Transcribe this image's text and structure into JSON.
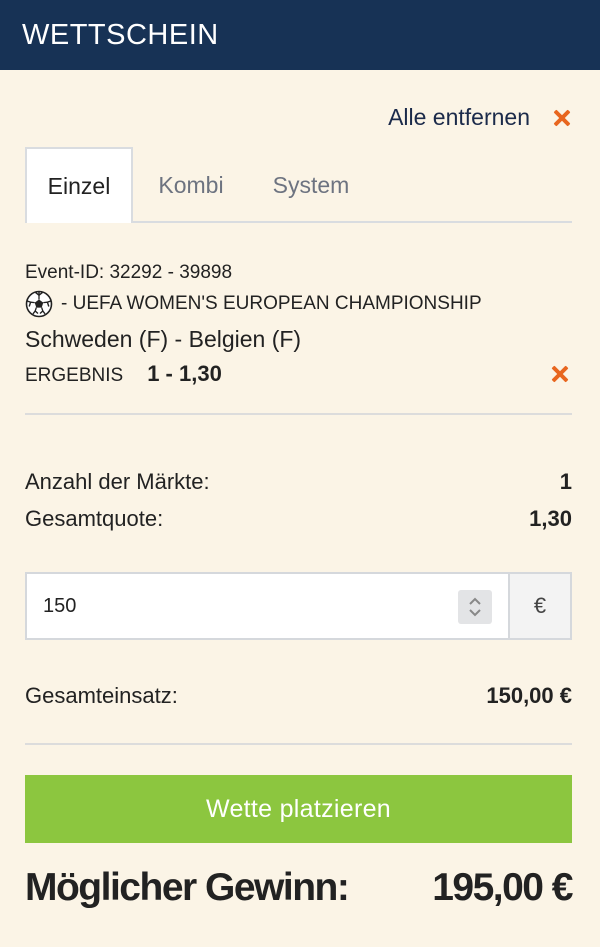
{
  "header": {
    "title": "WETTSCHEIN"
  },
  "remove_all": {
    "label": "Alle entfernen"
  },
  "tabs": [
    {
      "label": "Einzel",
      "active": true
    },
    {
      "label": "Kombi",
      "active": false
    },
    {
      "label": "System",
      "active": false
    }
  ],
  "bet": {
    "event_id": "Event-ID: 32292 - 39898",
    "league": "- UEFA WOMEN'S EUROPEAN CHAMPIONSHIP",
    "match": "Schweden (F) - Belgien (F)",
    "market": "ERGEBNIS",
    "selection_odds": "1 - 1,30",
    "sport_icon": "soccer-ball-icon"
  },
  "summary": {
    "markets_label": "Anzahl der Märkte:",
    "markets_value": "1",
    "total_odds_label": "Gesamtquote:",
    "total_odds_value": "1,30"
  },
  "stake": {
    "value": "150",
    "currency": "€"
  },
  "total_stake": {
    "label": "Gesamteinsatz:",
    "value": "150,00 €"
  },
  "place_bet": {
    "label": "Wette platzieren"
  },
  "potential_win": {
    "label": "Möglicher Gewinn:",
    "value": "195,00 €"
  },
  "colors": {
    "header_bg": "#173255",
    "page_bg": "#fbf4e6",
    "accent_remove": "#e8661f",
    "place_bet_bg": "#8cc63f"
  }
}
